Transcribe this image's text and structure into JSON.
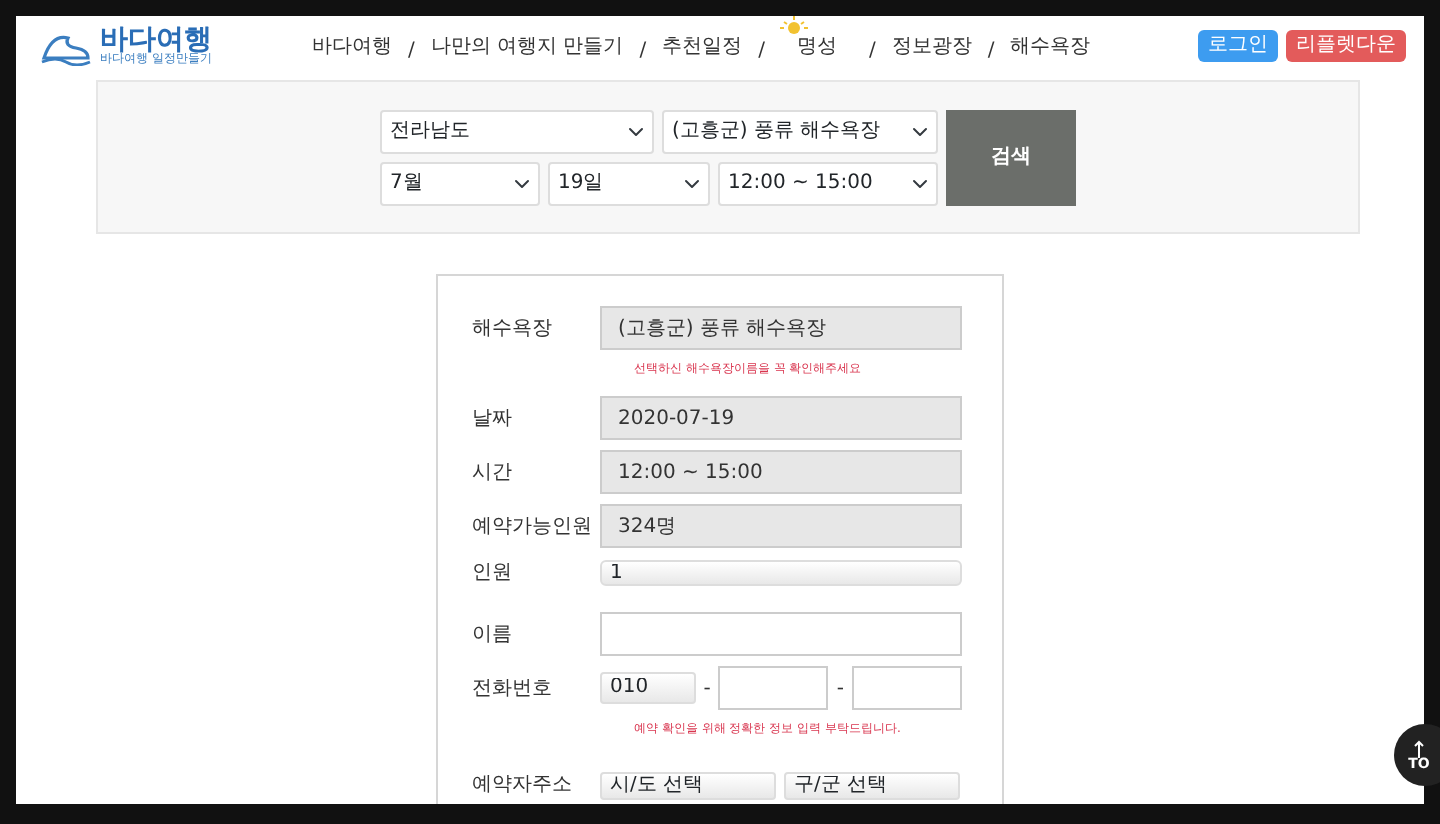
{
  "header": {
    "logo": {
      "title": "바다여행",
      "subtitle": "바다여행 일정만들기"
    },
    "nav": [
      {
        "kind": "link",
        "label": "바다여행"
      },
      {
        "kind": "separator",
        "label": "/"
      },
      {
        "kind": "link",
        "label": "나만의 여행지 만들기"
      },
      {
        "kind": "separator",
        "label": "/"
      },
      {
        "kind": "link",
        "label": "추천일정"
      },
      {
        "kind": "separator",
        "label": "/"
      },
      {
        "kind": "sun-link",
        "label": "명성"
      },
      {
        "kind": "separator",
        "label": "/"
      },
      {
        "kind": "link",
        "label": "정보광장"
      },
      {
        "kind": "separator",
        "label": "/"
      },
      {
        "kind": "link",
        "label": "해수욕장"
      }
    ],
    "buttons": [
      {
        "kind": "primary",
        "label": "로그인"
      },
      {
        "kind": "danger",
        "label": "리플렛다운"
      }
    ]
  },
  "search": {
    "region": "전라남도",
    "beach": "(고흥군) 풍류 해수욕장",
    "month": "7월",
    "day": "19일",
    "time": "12:00 ~ 15:00",
    "button": "검색"
  },
  "form": {
    "rows": [
      {
        "kind": "readonly",
        "label": "해수욕장",
        "value": "(고흥군) 풍류 해수욕장",
        "hint": "선택하신 해수욕장이름을 꼭 확인해주세요"
      },
      {
        "kind": "readonly",
        "label": "날짜",
        "value": "2020-07-19"
      },
      {
        "kind": "readonly",
        "label": "시간",
        "value": "12:00 ~ 15:00"
      },
      {
        "kind": "readonly",
        "label": "예약가능인원",
        "value": "324명"
      },
      {
        "kind": "select",
        "label": "인원",
        "value": "1"
      },
      {
        "kind": "text",
        "label": "이름"
      },
      {
        "kind": "phone",
        "label": "전화번호",
        "value": "010",
        "separators": [
          "-",
          "-"
        ],
        "hint": "예약 확인을 위해 정확한 정보 입력 부탁드립니다."
      },
      {
        "kind": "address",
        "label": "예약자주소",
        "options": [
          "시/도 선택",
          "구/군 선택"
        ]
      }
    ]
  },
  "top_button": {
    "label": "TO"
  }
}
